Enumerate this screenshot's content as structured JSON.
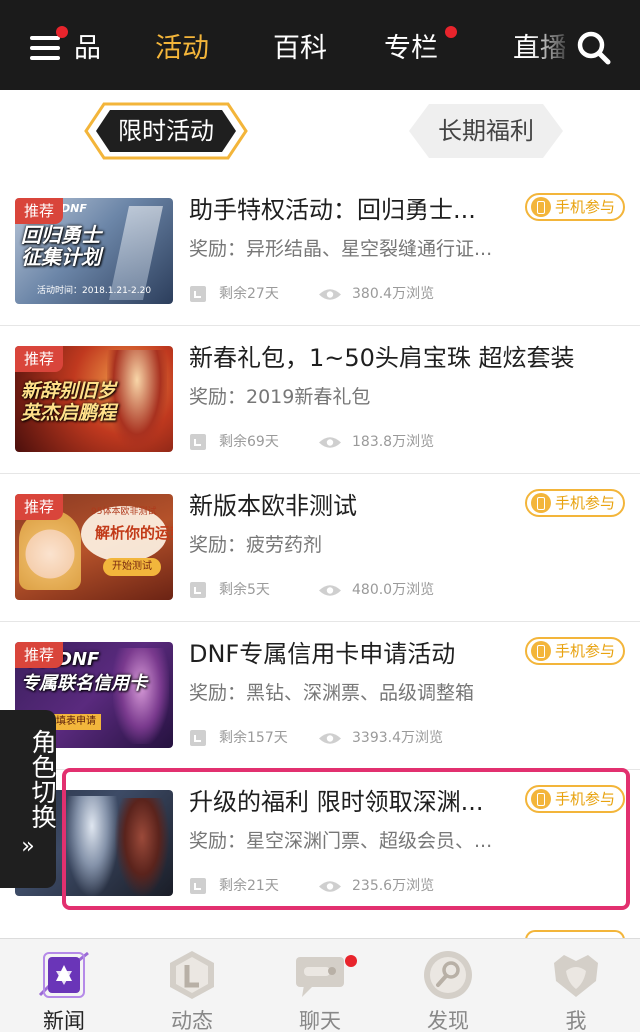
{
  "colors": {
    "accent": "#f3b53a",
    "topbar": "#1b1b1b",
    "tag": "#d9453b",
    "highlight": "#e2306f",
    "notify": "#e8242c"
  },
  "topnav": {
    "items": [
      {
        "label": "品"
      },
      {
        "label": "活动",
        "active": true
      },
      {
        "label": "百科"
      },
      {
        "label": "专栏",
        "dot": true
      },
      {
        "label": "直播"
      }
    ]
  },
  "segments": {
    "active": "限时活动",
    "inactive": "长期福利"
  },
  "badge_label": "手机参与",
  "activities": [
    {
      "tag": "推荐",
      "thumb_text": "回归勇士\n征集计划",
      "thumb_sub": "活动时间：2018.1.21-2.20",
      "thumb_brand": "DNF",
      "title": "助手特权活动：回归勇士...",
      "reward": "奖励：异形结晶、星空裂缝通行证...",
      "remaining": "剩余27天",
      "views": "380.4万浏览",
      "badge": true
    },
    {
      "tag": "推荐",
      "thumb_text": "新辞别旧岁\n英杰启鹏程",
      "title": "新春礼包，1~50头肩宝珠 超炫套装",
      "reward": "奖励：2019新春礼包",
      "remaining": "剩余69天",
      "views": "183.8万浏览",
      "badge": false
    },
    {
      "tag": "推荐",
      "thumb_text": "解析你的运势",
      "thumb_sub": "95体本欧非测试",
      "thumb_button": "开始测试",
      "title": "新版本欧非测试",
      "reward": "奖励：疲劳药剂",
      "remaining": "剩余5天",
      "views": "480.0万浏览",
      "badge": true
    },
    {
      "tag": "推荐",
      "thumb_text": "平安DNF\n专属联名信用卡",
      "thumb_sub": "点击填表申请",
      "title": "DNF专属信用卡申请活动",
      "reward": "奖励：黑钻、深渊票、品级调整箱",
      "remaining": "剩余157天",
      "views": "3393.4万浏览",
      "badge": true
    },
    {
      "tag": "",
      "thumb_text": "",
      "title": "升级的福利 限时领取深渊...",
      "reward": "奖励：星空深渊门票、超级会员、...",
      "remaining": "剩余21天",
      "views": "235.6万浏览",
      "badge": true,
      "highlighted": true
    }
  ],
  "role_switch": {
    "label": "角色切换",
    "arrow": "»"
  },
  "tabbar": {
    "items": [
      {
        "label": "新闻",
        "icon": "news-icon",
        "active": true
      },
      {
        "label": "动态",
        "icon": "feed-icon"
      },
      {
        "label": "聊天",
        "icon": "chat-icon",
        "dot": true
      },
      {
        "label": "发现",
        "icon": "discover-icon"
      },
      {
        "label": "我",
        "icon": "profile-icon"
      }
    ]
  }
}
